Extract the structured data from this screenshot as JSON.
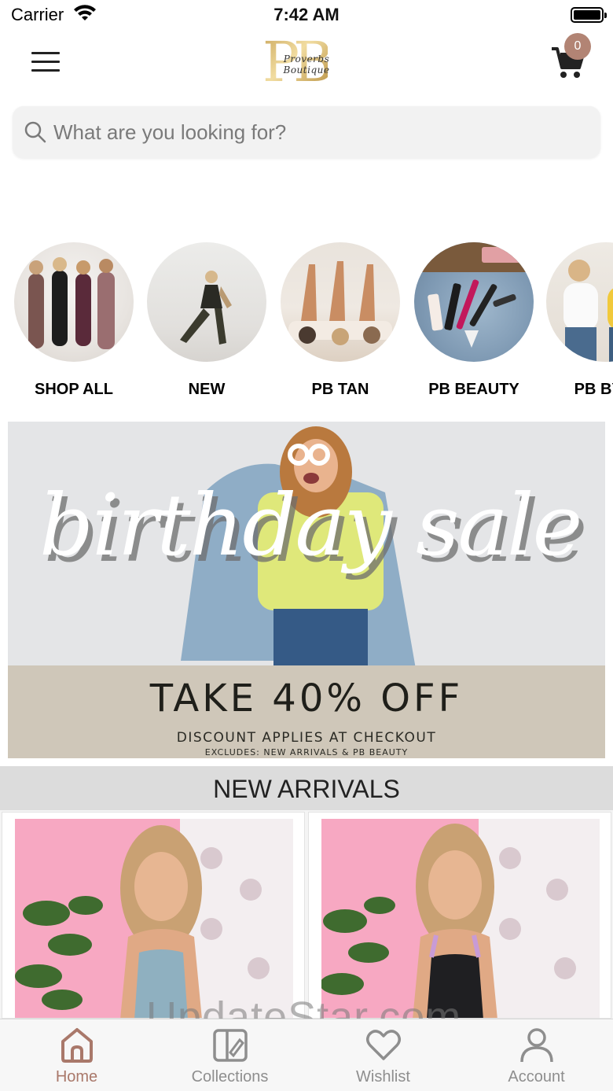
{
  "status_bar": {
    "carrier": "Carrier",
    "time": "7:42 AM"
  },
  "header": {
    "logo_monogram": "PB",
    "logo_script": "Proverbs Boutique",
    "cart_count": "0"
  },
  "search": {
    "placeholder": "What are you looking for?"
  },
  "categories": [
    {
      "label": "SHOP ALL"
    },
    {
      "label": "NEW"
    },
    {
      "label": "PB TAN"
    },
    {
      "label": "PB BEAUTY"
    },
    {
      "label": "PB BY D"
    }
  ],
  "banner": {
    "script_text": "birthday sale",
    "headline": "TAKE 40% OFF",
    "note": "DISCOUNT APPLIES AT CHECKOUT",
    "exclusion": "EXCLUDES: NEW ARRIVALS & PB BEAUTY"
  },
  "new_arrivals": {
    "title": "NEW ARRIVALS"
  },
  "watermark": "UpdateStar.com",
  "tab_bar": {
    "tabs": [
      {
        "label": "Home",
        "icon": "home-icon",
        "active": true
      },
      {
        "label": "Collections",
        "icon": "collections-icon",
        "active": false
      },
      {
        "label": "Wishlist",
        "icon": "heart-icon",
        "active": false
      },
      {
        "label": "Account",
        "icon": "account-icon",
        "active": false
      }
    ]
  },
  "colors": {
    "accent": "#a9786a",
    "badge": "#b28474",
    "banner_band": "#cfc7b9",
    "section_header": "#dcdcdc"
  }
}
